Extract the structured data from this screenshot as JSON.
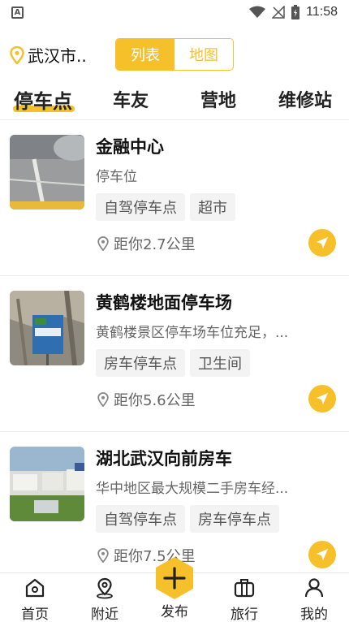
{
  "status_bar": {
    "time": "11:58",
    "app_icon_letter": "A"
  },
  "header": {
    "city": "武汉市..",
    "toggle": {
      "list": "列表",
      "map": "地图",
      "selected": "list"
    }
  },
  "tabs": [
    {
      "label": "停车点",
      "active": true
    },
    {
      "label": "车友",
      "active": false
    },
    {
      "label": "营地",
      "active": false
    },
    {
      "label": "维修站",
      "active": false
    }
  ],
  "items": [
    {
      "title": "金融中心",
      "desc": "停车位",
      "tags": [
        "自驾停车点",
        "超市"
      ],
      "distance": "距你2.7公里"
    },
    {
      "title": "黄鹤楼地面停车场",
      "desc": "黄鹤楼景区停车场车位充足，...",
      "tags": [
        "房车停车点",
        "卫生间"
      ],
      "distance": "距你5.6公里"
    },
    {
      "title": "湖北武汉向前房车",
      "desc": "华中地区最大规模二手房车经...",
      "tags": [
        "自驾停车点",
        "房车停车点"
      ],
      "distance": "距你7.5公里"
    }
  ],
  "bottom_nav": {
    "home": "首页",
    "nearby": "附近",
    "publish": "发布",
    "travel": "旅行",
    "mine": "我的"
  },
  "colors": {
    "accent": "#f5c02a"
  }
}
